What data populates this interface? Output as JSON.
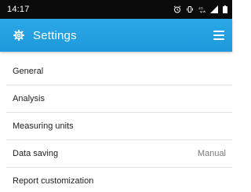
{
  "status_bar": {
    "time": "14:17",
    "icons": [
      "alarm-icon",
      "vibrate-icon",
      "network-4g-icon",
      "signal-icon",
      "battery-icon"
    ]
  },
  "app_bar": {
    "title": "Settings",
    "icon": "gear-icon",
    "menu_icon": "hamburger-menu-icon",
    "color": "#1e99dc"
  },
  "settings": {
    "items": [
      {
        "label": "General",
        "value": ""
      },
      {
        "label": "Analysis",
        "value": ""
      },
      {
        "label": "Measuring units",
        "value": ""
      },
      {
        "label": "Data saving",
        "value": "Manual"
      },
      {
        "label": "Report customization",
        "value": ""
      }
    ]
  }
}
